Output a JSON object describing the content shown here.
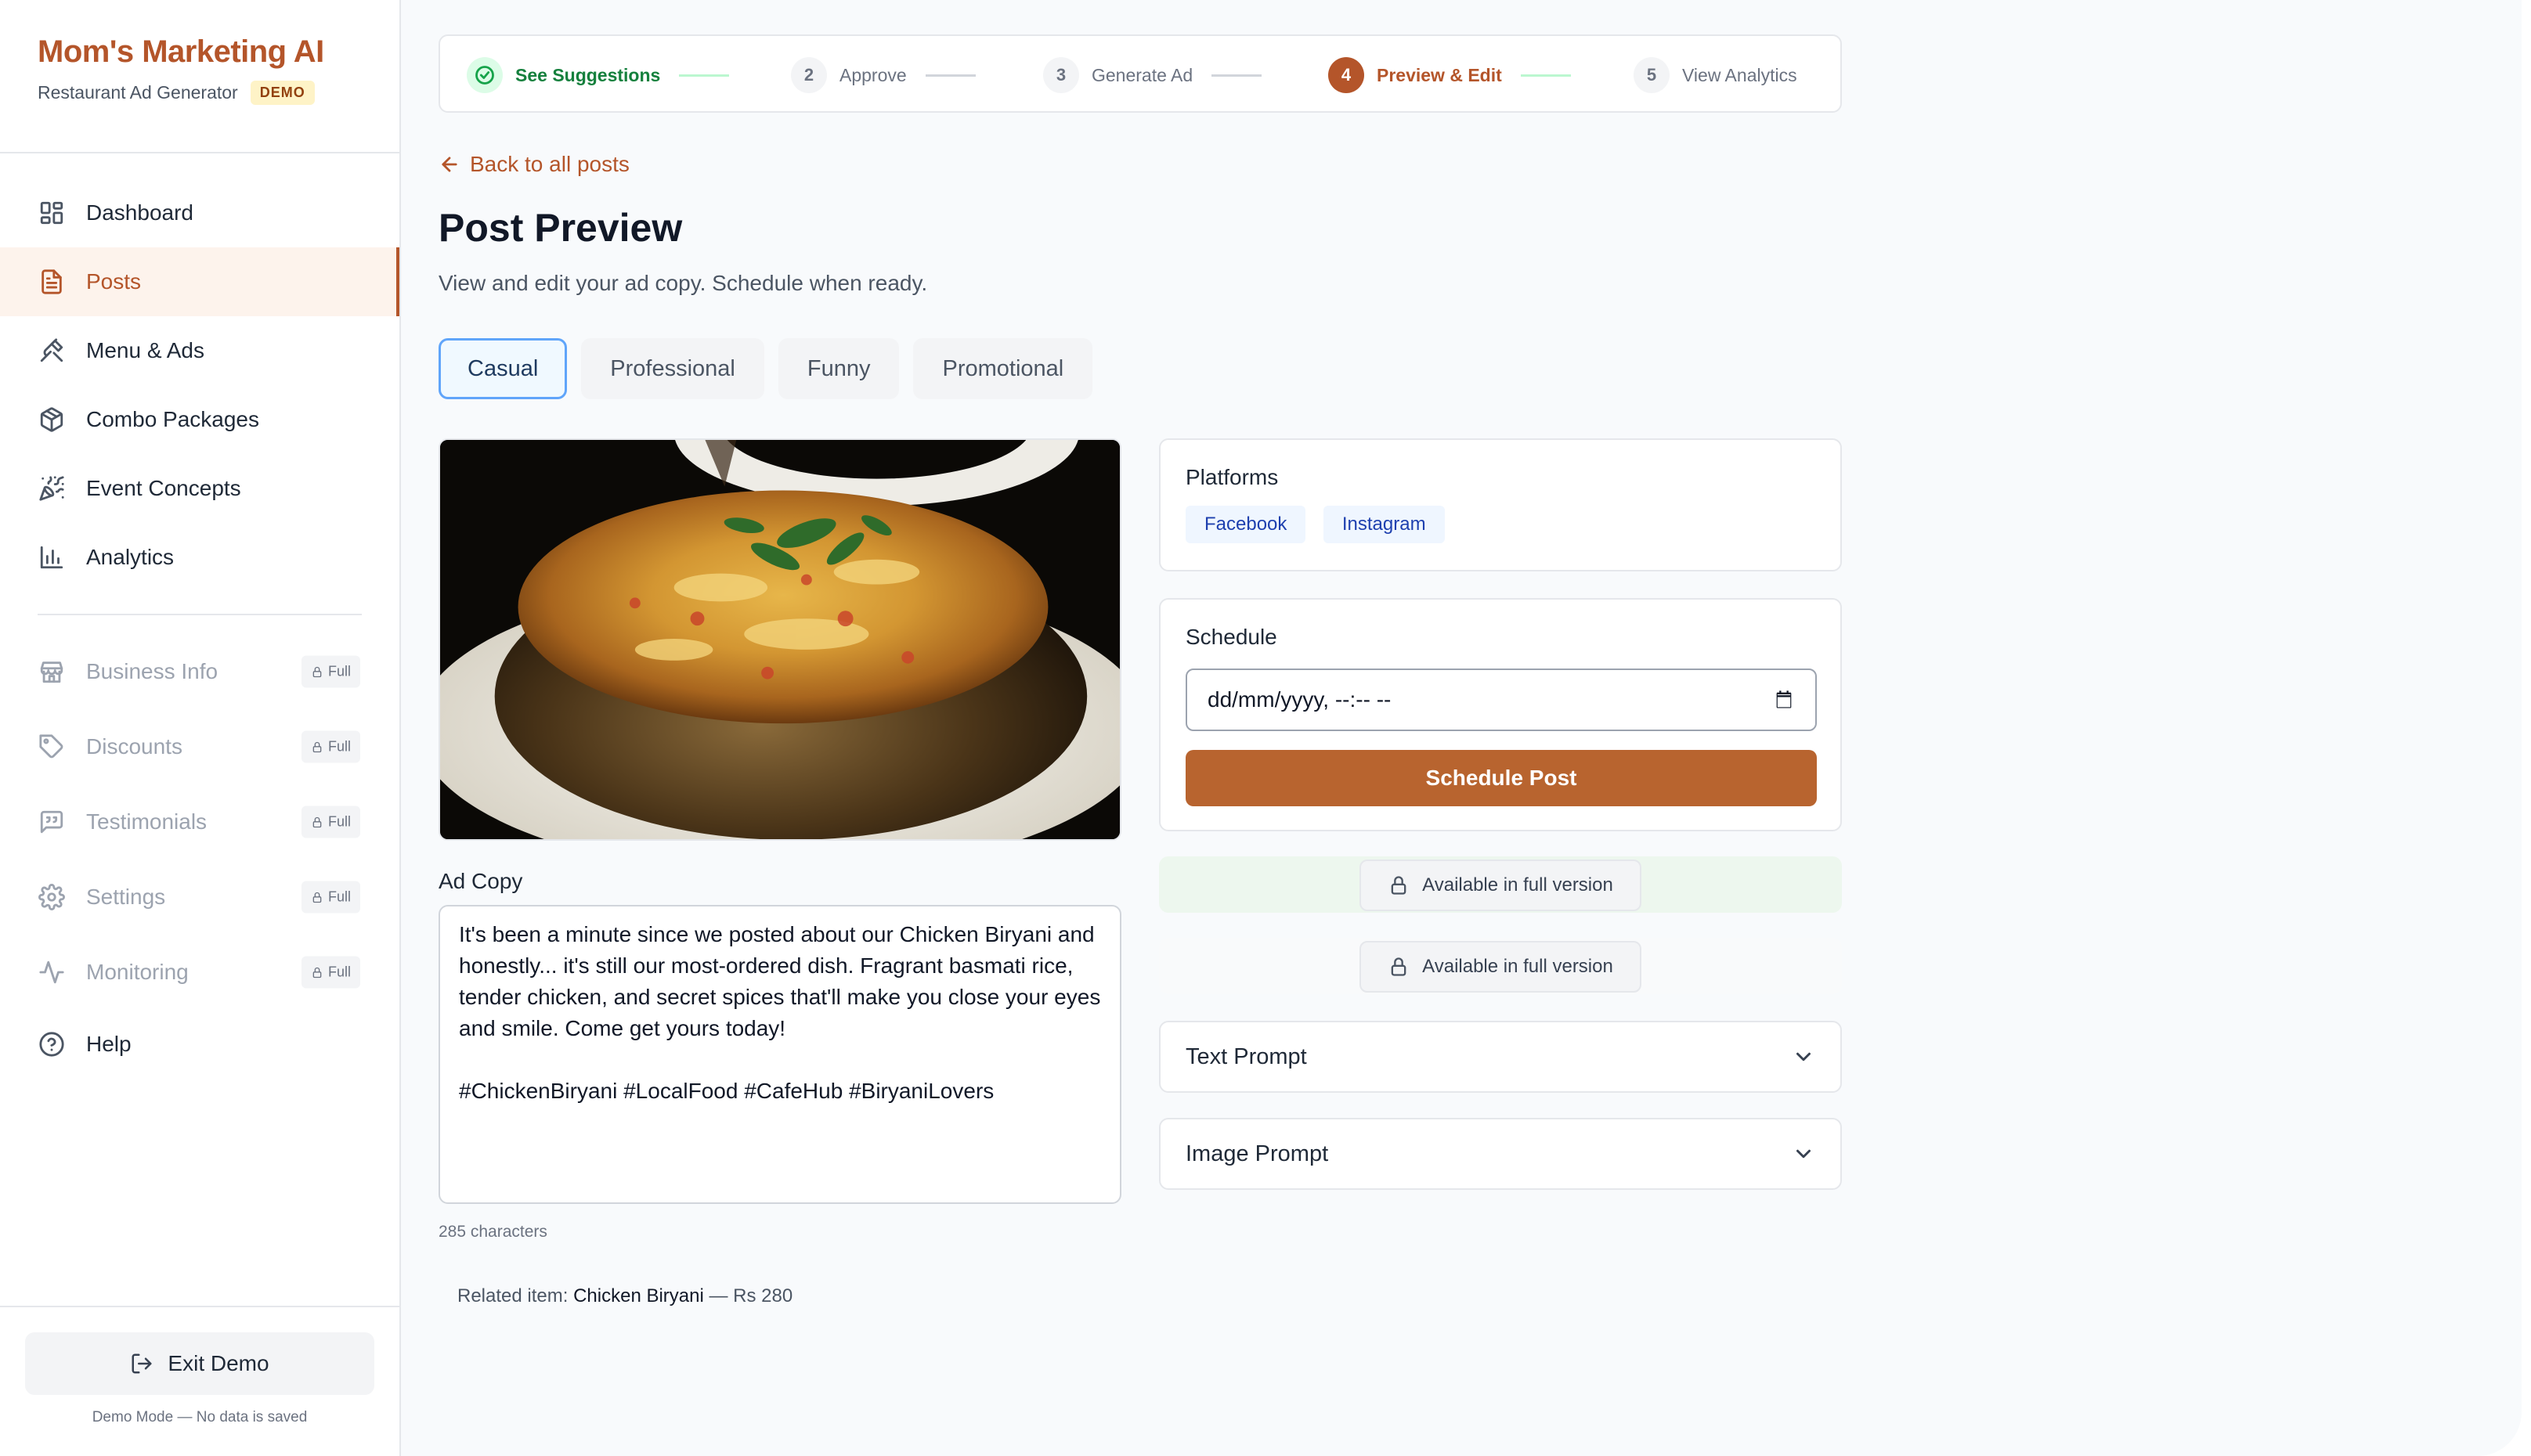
{
  "brand": {
    "title": "Mom's Marketing AI",
    "subtitle": "Restaurant Ad Generator",
    "badge": "DEMO"
  },
  "sidebar": {
    "items": [
      {
        "label": "Dashboard",
        "icon": "layout-dashboard-icon"
      },
      {
        "label": "Posts",
        "icon": "file-text-icon",
        "active": true
      },
      {
        "label": "Menu & Ads",
        "icon": "utensils-icon"
      },
      {
        "label": "Combo Packages",
        "icon": "package-icon"
      },
      {
        "label": "Event Concepts",
        "icon": "party-popper-icon"
      },
      {
        "label": "Analytics",
        "icon": "bar-chart-icon"
      }
    ],
    "locked_items": [
      {
        "label": "Business Info",
        "icon": "store-icon",
        "badge": "Full"
      },
      {
        "label": "Discounts",
        "icon": "tag-icon",
        "badge": "Full"
      },
      {
        "label": "Testimonials",
        "icon": "message-square-quote-icon",
        "badge": "Full"
      },
      {
        "label": "Settings",
        "icon": "gear-icon",
        "badge": "Full"
      },
      {
        "label": "Monitoring",
        "icon": "activity-icon",
        "badge": "Full"
      }
    ],
    "help": {
      "label": "Help",
      "icon": "help-circle-icon"
    },
    "exit_label": "Exit Demo",
    "demo_note": "Demo Mode — No data is saved"
  },
  "stepper": {
    "steps": [
      {
        "num": "1",
        "label": "See Suggestions",
        "state": "done"
      },
      {
        "num": "2",
        "label": "Approve",
        "state": "pending"
      },
      {
        "num": "3",
        "label": "Generate Ad",
        "state": "pending"
      },
      {
        "num": "4",
        "label": "Preview & Edit",
        "state": "current"
      },
      {
        "num": "5",
        "label": "View Analytics",
        "state": "pending"
      }
    ]
  },
  "back_link": "Back to all posts",
  "page": {
    "title": "Post Preview",
    "subtitle": "View and edit your ad copy. Schedule when ready."
  },
  "tones": [
    {
      "label": "Casual",
      "active": true
    },
    {
      "label": "Professional"
    },
    {
      "label": "Funny"
    },
    {
      "label": "Promotional"
    }
  ],
  "ad_copy": {
    "label": "Ad Copy",
    "text": "It's been a minute since we posted about our Chicken Biryani and honestly... it's still our most-ordered dish. Fragrant basmati rice, tender chicken, and secret spices that'll make you close your eyes and smile. Come get yours today!\n\n#ChickenBiryani #LocalFood #CafeHub #BiryaniLovers",
    "char_count": "285 characters"
  },
  "related": {
    "prefix": "Related item:",
    "item": "Chicken Biryani",
    "price": "— Rs 280"
  },
  "platforms": {
    "title": "Platforms",
    "chips": [
      "Facebook",
      "Instagram"
    ]
  },
  "schedule": {
    "title": "Schedule",
    "placeholder": "dd/mm/yyyy, --:-- --",
    "button": "Schedule Post"
  },
  "locked_features": [
    "Available in full version",
    "Available in full version"
  ],
  "accordions": [
    "Text Prompt",
    "Image Prompt"
  ],
  "colors": {
    "accent": "#b4552a",
    "button": "#b8642f",
    "success": "#16a34a",
    "chip_bg": "#eff6ff",
    "chip_text": "#1e40af"
  }
}
